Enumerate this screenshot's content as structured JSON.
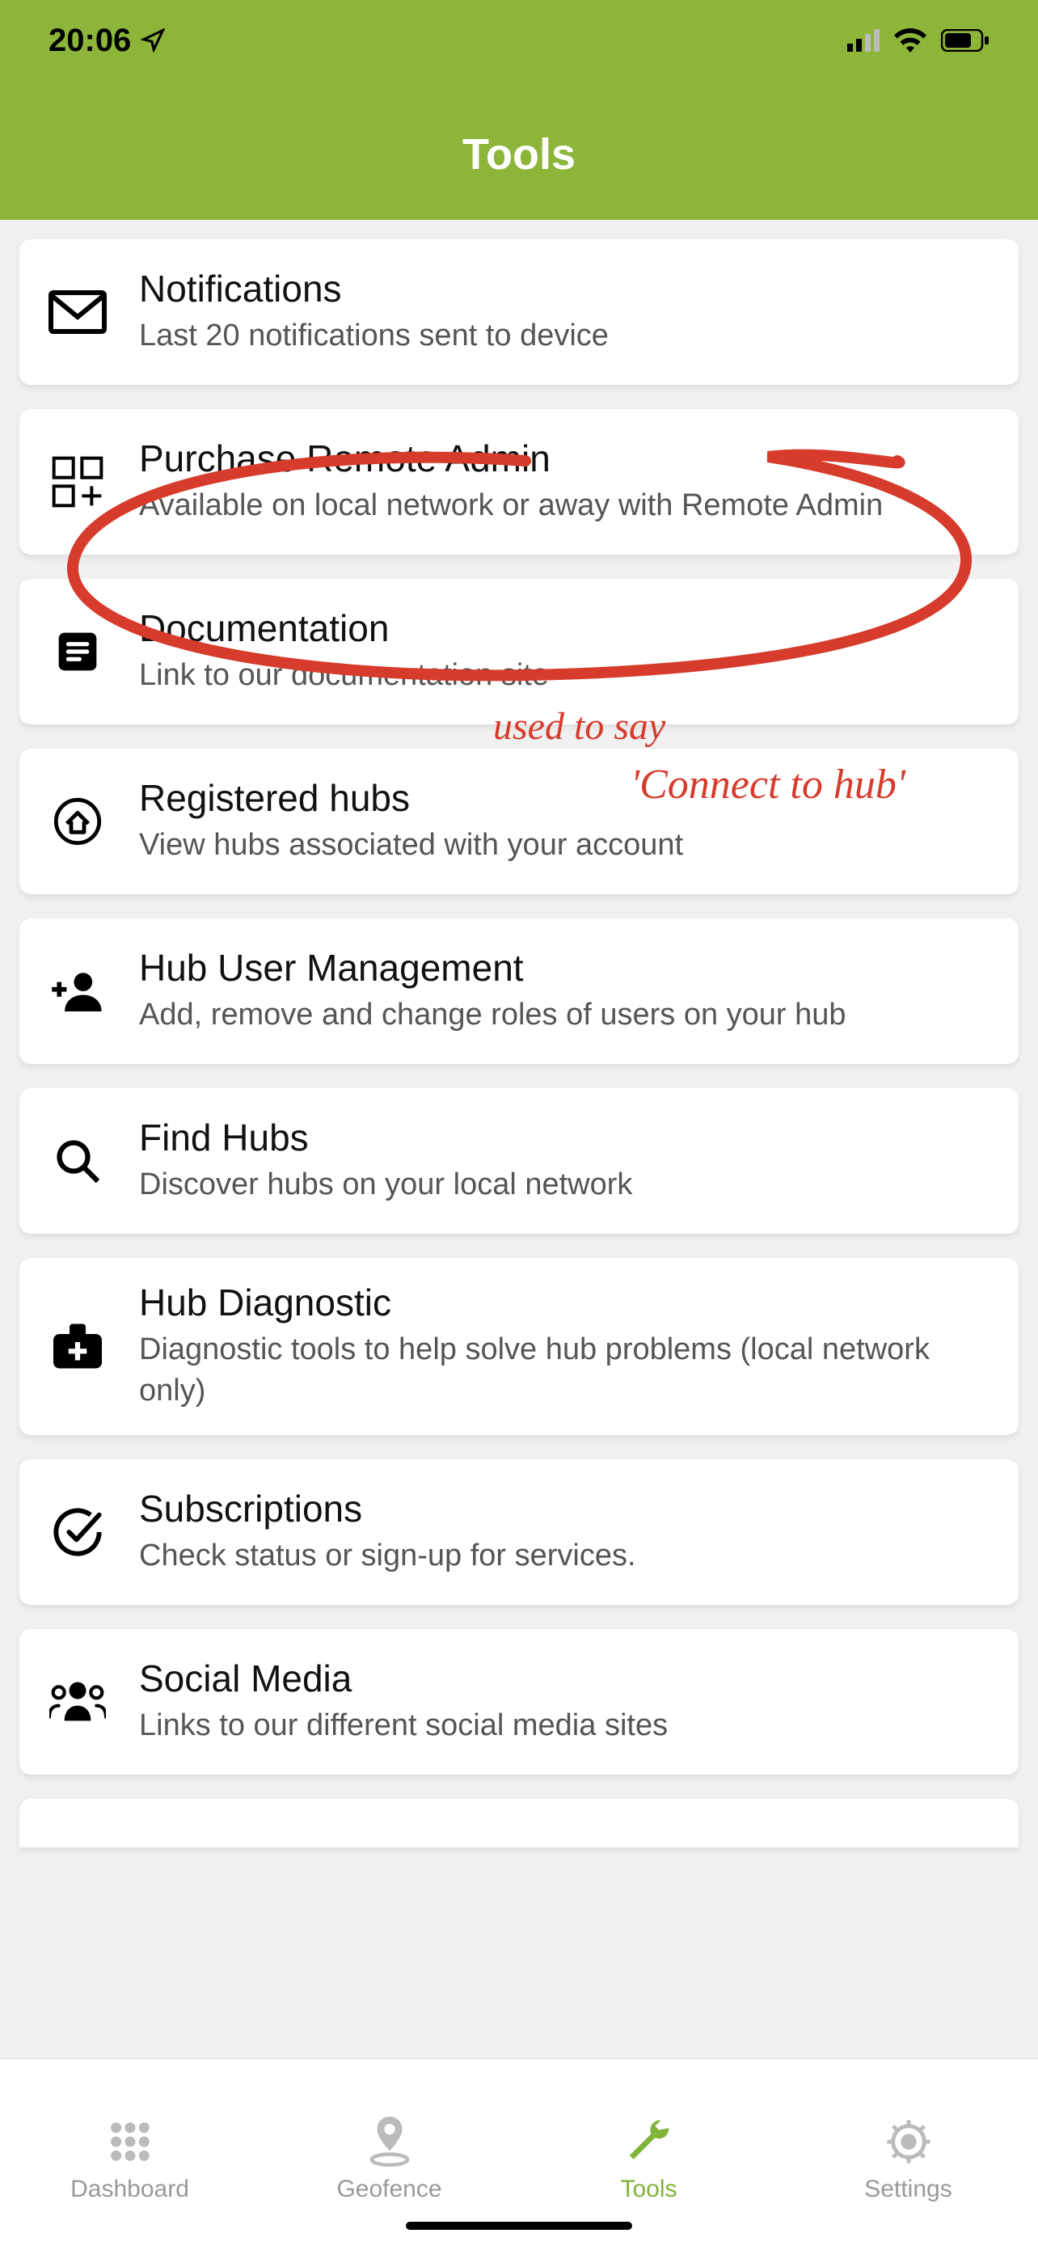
{
  "status": {
    "time": "20:06"
  },
  "header": {
    "title": "Tools"
  },
  "items": [
    {
      "icon": "mail",
      "title": "Notifications",
      "subtitle": "Last 20 notifications sent to device"
    },
    {
      "icon": "grid-plus",
      "title": "Purchase Remote Admin",
      "subtitle": "Available on local network or away with Remote Admin"
    },
    {
      "icon": "doc",
      "title": "Documentation",
      "subtitle": "Link to our documentation site"
    },
    {
      "icon": "home-circle",
      "title": "Registered hubs",
      "subtitle": "View hubs associated with your account"
    },
    {
      "icon": "person-plus",
      "title": "Hub User Management",
      "subtitle": "Add, remove and change roles of users on your hub"
    },
    {
      "icon": "search",
      "title": "Find Hubs",
      "subtitle": "Discover hubs on your local network"
    },
    {
      "icon": "medkit",
      "title": "Hub Diagnostic",
      "subtitle": "Diagnostic tools to help solve hub problems (local network only)"
    },
    {
      "icon": "check-circle",
      "title": "Subscriptions",
      "subtitle": "Check status or sign-up for services."
    },
    {
      "icon": "social",
      "title": "Social Media",
      "subtitle": "Links to our different social media sites"
    }
  ],
  "partial_item_title": "",
  "tabs": [
    {
      "icon": "grid-dots",
      "label": "Dashboard",
      "active": false
    },
    {
      "icon": "pin",
      "label": "Geofence",
      "active": false
    },
    {
      "icon": "wrench",
      "label": "Tools",
      "active": true
    },
    {
      "icon": "gear",
      "label": "Settings",
      "active": false
    }
  ],
  "annotation": {
    "line1": "used to say",
    "line2": "'Connect to hub'"
  },
  "colors": {
    "accent": "#8db53a",
    "annotation": "#d63b2c"
  }
}
